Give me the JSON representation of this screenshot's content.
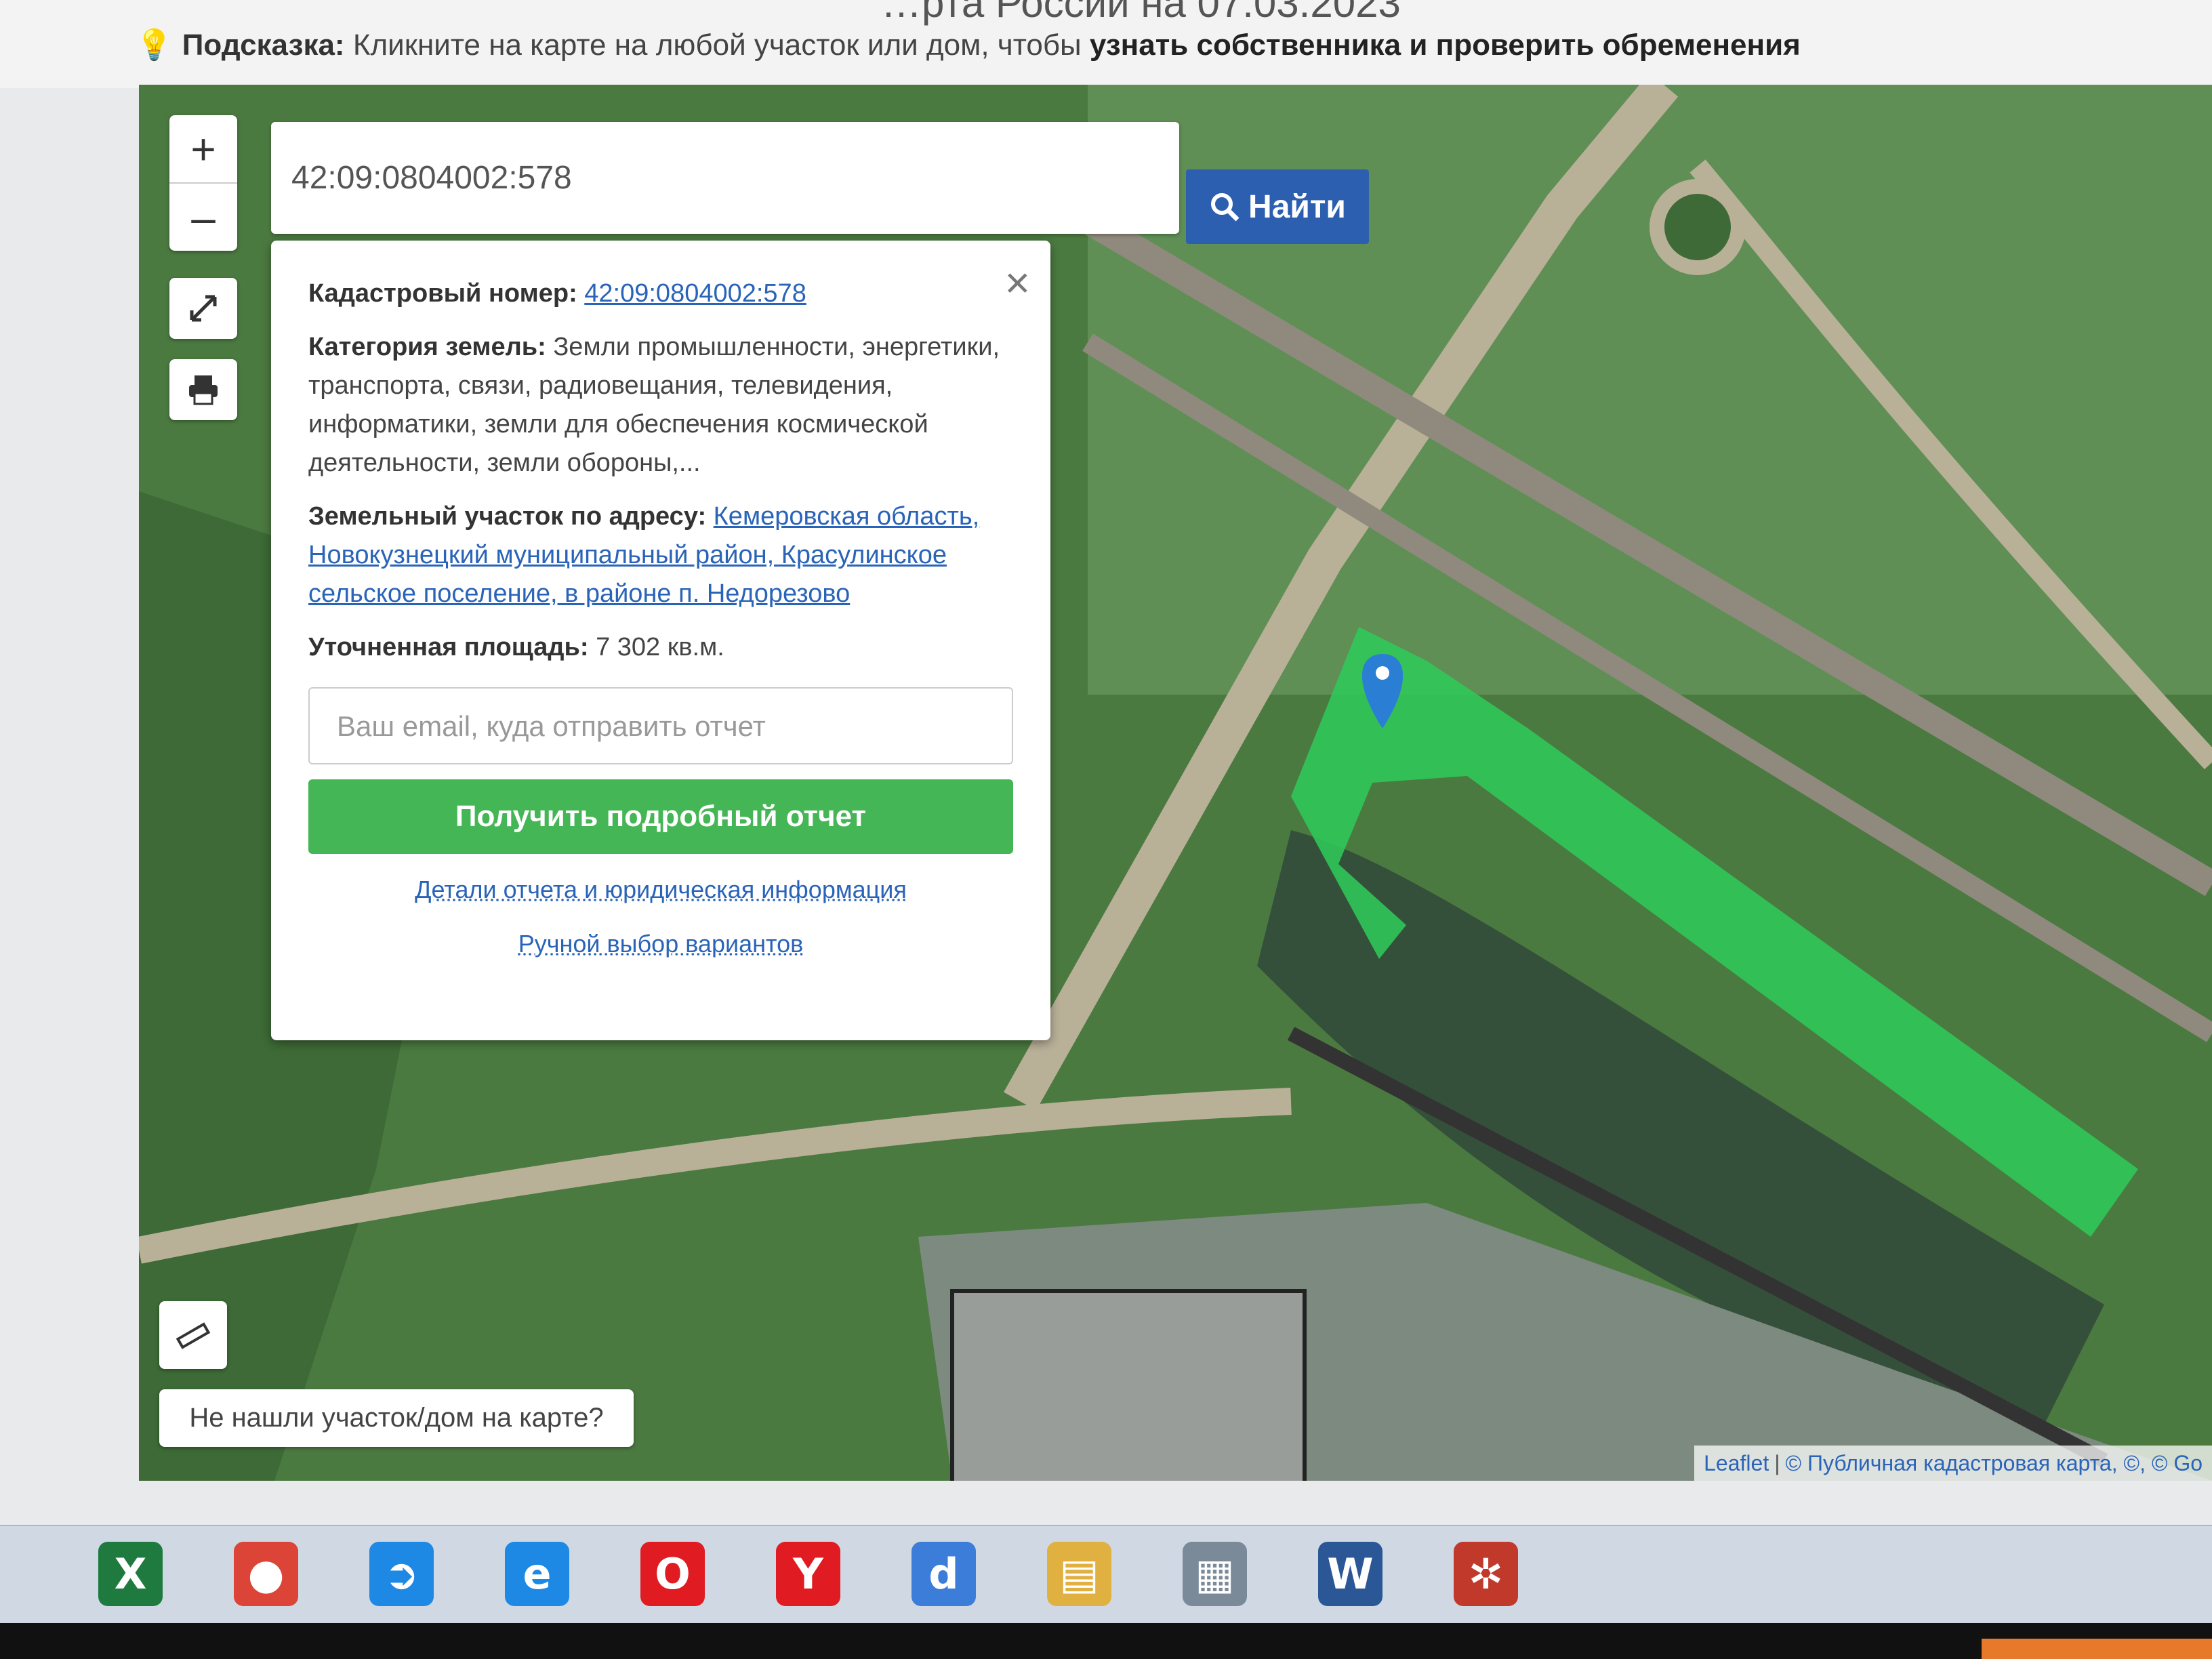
{
  "header": {
    "title": "…рта России на 07.03.2023",
    "hint_label": "Подсказка:",
    "hint_text": "Кликните на карте на любой участок или дом, чтобы",
    "hint_strong": "узнать собственника и проверить обременения"
  },
  "map": {
    "zoom_in": "+",
    "zoom_out": "–",
    "search": {
      "value": "42:09:0804002:578",
      "button": "Найти"
    },
    "popup": {
      "cadastral_label": "Кадастровый номер:",
      "cadastral_value": "42:09:0804002:578",
      "category_label": "Категория земель:",
      "category_value": "Земли промышленности, энергетики, транспорта, связи, радиовещания, телевидения, информатики, земли для обеспечения космической деятельности, земли обороны,...",
      "address_label": "Земельный участок по адресу:",
      "address_value": "Кемеровская область, Новокузнецкий муниципальный район, Красулинское сельское поселение, в районе п. Недорезово",
      "area_label": "Уточненная площадь:",
      "area_value": "7 302 кв.м.",
      "email_placeholder": "Ваш email, куда отправить отчет",
      "report_button": "Получить подробный отчет",
      "details_link": "Детали отчета и юридическая информация",
      "manual_link": "Ручной выбор вариантов"
    },
    "not_found": "Не нашли участок/дом на карте?",
    "attribution": {
      "leaflet": "Leaflet",
      "rest": "© Публичная кадастровая карта, ©, © Go"
    }
  },
  "taskbar": {
    "apps": [
      {
        "name": "excel-icon",
        "glyph": "X",
        "color": "#1f7a3f"
      },
      {
        "name": "chrome-icon",
        "glyph": "●",
        "color": "#db4437"
      },
      {
        "name": "skype-like-icon",
        "glyph": "➲",
        "color": "#1e88e5"
      },
      {
        "name": "internet-explorer-icon",
        "glyph": "e",
        "color": "#1e88e5"
      },
      {
        "name": "opera-icon",
        "glyph": "O",
        "color": "#e01b22"
      },
      {
        "name": "yandex-browser-icon",
        "glyph": "Y",
        "color": "#e01b22"
      },
      {
        "name": "app-d-icon",
        "glyph": "d",
        "color": "#3b7dd8"
      },
      {
        "name": "file-explorer-icon",
        "glyph": "▤",
        "color": "#e0b040"
      },
      {
        "name": "scanner-icon",
        "glyph": "▦",
        "color": "#7a8a99"
      },
      {
        "name": "word-icon",
        "glyph": "W",
        "color": "#2b5797"
      },
      {
        "name": "app-settings-icon",
        "glyph": "✲",
        "color": "#c0392b"
      }
    ]
  }
}
